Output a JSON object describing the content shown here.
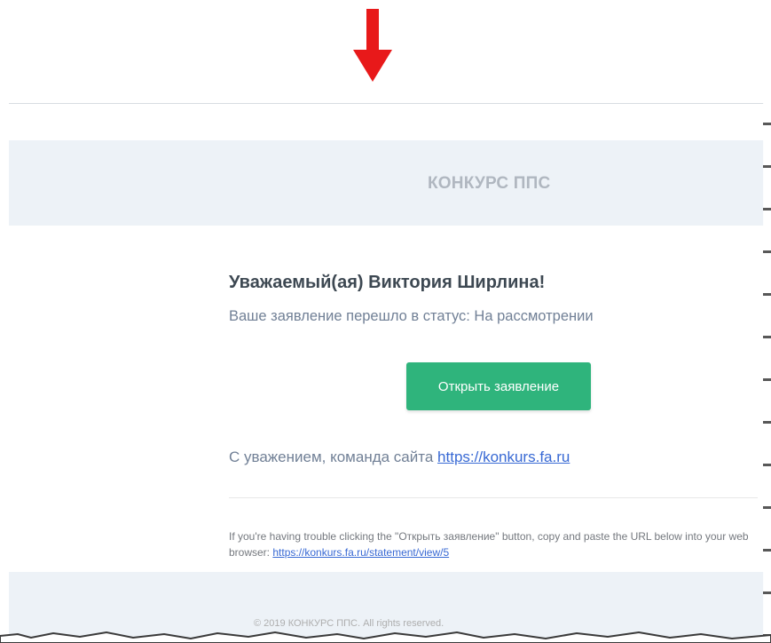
{
  "annotation": {
    "arrow_color": "#e8191a"
  },
  "email": {
    "header_title": "КОНКУРС ППС",
    "greeting": "Уважаемый(ая) Виктория Ширлина!",
    "status_line": "Ваше заявление перешло в статус: На рассмотрении",
    "button_label": "Открыть заявление",
    "regards_text": "С уважением, команда сайта",
    "regards_link": "https://konkurs.fa.ru",
    "trouble_text_1": "If you're having trouble clicking the \"Открыть заявление\" button, copy and paste the URL below into your web browser:",
    "trouble_link": "https://konkurs.fa.ru/statement/view/5",
    "footer": "© 2019 КОНКУРС ППС. All rights reserved."
  },
  "colors": {
    "button": "#2fb47c",
    "header_bg": "#edf2f7",
    "link": "#3869d4"
  }
}
